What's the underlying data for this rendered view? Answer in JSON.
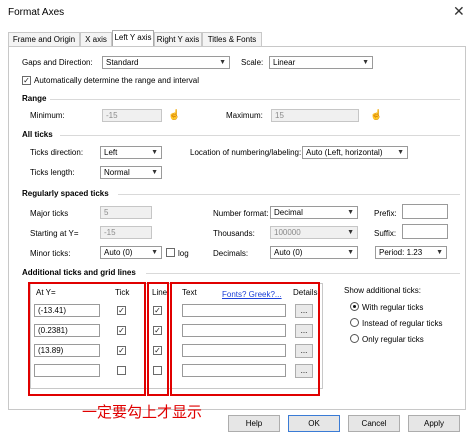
{
  "window": {
    "title": "Format Axes",
    "close_glyph": "✕"
  },
  "tabs": [
    {
      "label": "Frame and Origin"
    },
    {
      "label": "X axis"
    },
    {
      "label": "Left Y axis"
    },
    {
      "label": "Right Y axis"
    },
    {
      "label": "Titles & Fonts"
    }
  ],
  "gaps": {
    "label": "Gaps and Direction:",
    "value": "Standard",
    "scale_label": "Scale:",
    "scale_value": "Linear"
  },
  "auto_range": {
    "label": "Automatically determine the range and interval",
    "checked": true
  },
  "range": {
    "heading": "Range",
    "min_label": "Minimum:",
    "min_value": "-15",
    "max_label": "Maximum:",
    "max_value": "15"
  },
  "all_ticks": {
    "heading": "All ticks",
    "direction_label": "Ticks direction:",
    "direction_value": "Left",
    "location_label": "Location of numbering/labeling:",
    "location_value": "Auto (Left, horizontal)",
    "length_label": "Ticks length:",
    "length_value": "Normal"
  },
  "regular": {
    "heading": "Regularly spaced ticks",
    "major_label": "Major ticks",
    "major_value": "5",
    "number_format_label": "Number format:",
    "number_format_value": "Decimal",
    "prefix_label": "Prefix:",
    "prefix_value": "",
    "start_label": "Starting at Y=",
    "start_value": "-15",
    "thousands_label": "Thousands:",
    "thousands_value": "100000",
    "suffix_label": "Suffix:",
    "suffix_value": "",
    "minor_label": "Minor ticks:",
    "minor_value": "Auto (0)",
    "log_label": "log",
    "decimals_label": "Decimals:",
    "decimals_value": "Auto (0)",
    "period_value": "Period: 1.23"
  },
  "additional": {
    "heading": "Additional ticks and grid lines",
    "col_at": "At Y=",
    "col_tick": "Tick",
    "col_line": "Line",
    "col_text": "Text",
    "fonts_link": "Fonts? Greek?...",
    "col_details": "Details",
    "rows": [
      {
        "at": "(-13.41)",
        "tick": true,
        "line": true,
        "text": "",
        "details": "..."
      },
      {
        "at": "(0.2381)",
        "tick": true,
        "line": true,
        "text": "",
        "details": "..."
      },
      {
        "at": "(13.89)",
        "tick": true,
        "line": true,
        "text": "",
        "details": "..."
      },
      {
        "at": "",
        "tick": false,
        "line": false,
        "text": "",
        "details": "..."
      }
    ],
    "show_heading": "Show additional ticks:",
    "options": [
      {
        "label": "With regular ticks",
        "selected": true
      },
      {
        "label": "Instead of regular ticks",
        "selected": false
      },
      {
        "label": "Only regular ticks",
        "selected": false
      }
    ]
  },
  "annotation": "一定要勾上才显示",
  "footer": {
    "help": "Help",
    "ok": "OK",
    "cancel": "Cancel",
    "apply": "Apply"
  },
  "colors": {
    "annotation_red": "#e00000",
    "link_blue": "#1a3fd8"
  }
}
